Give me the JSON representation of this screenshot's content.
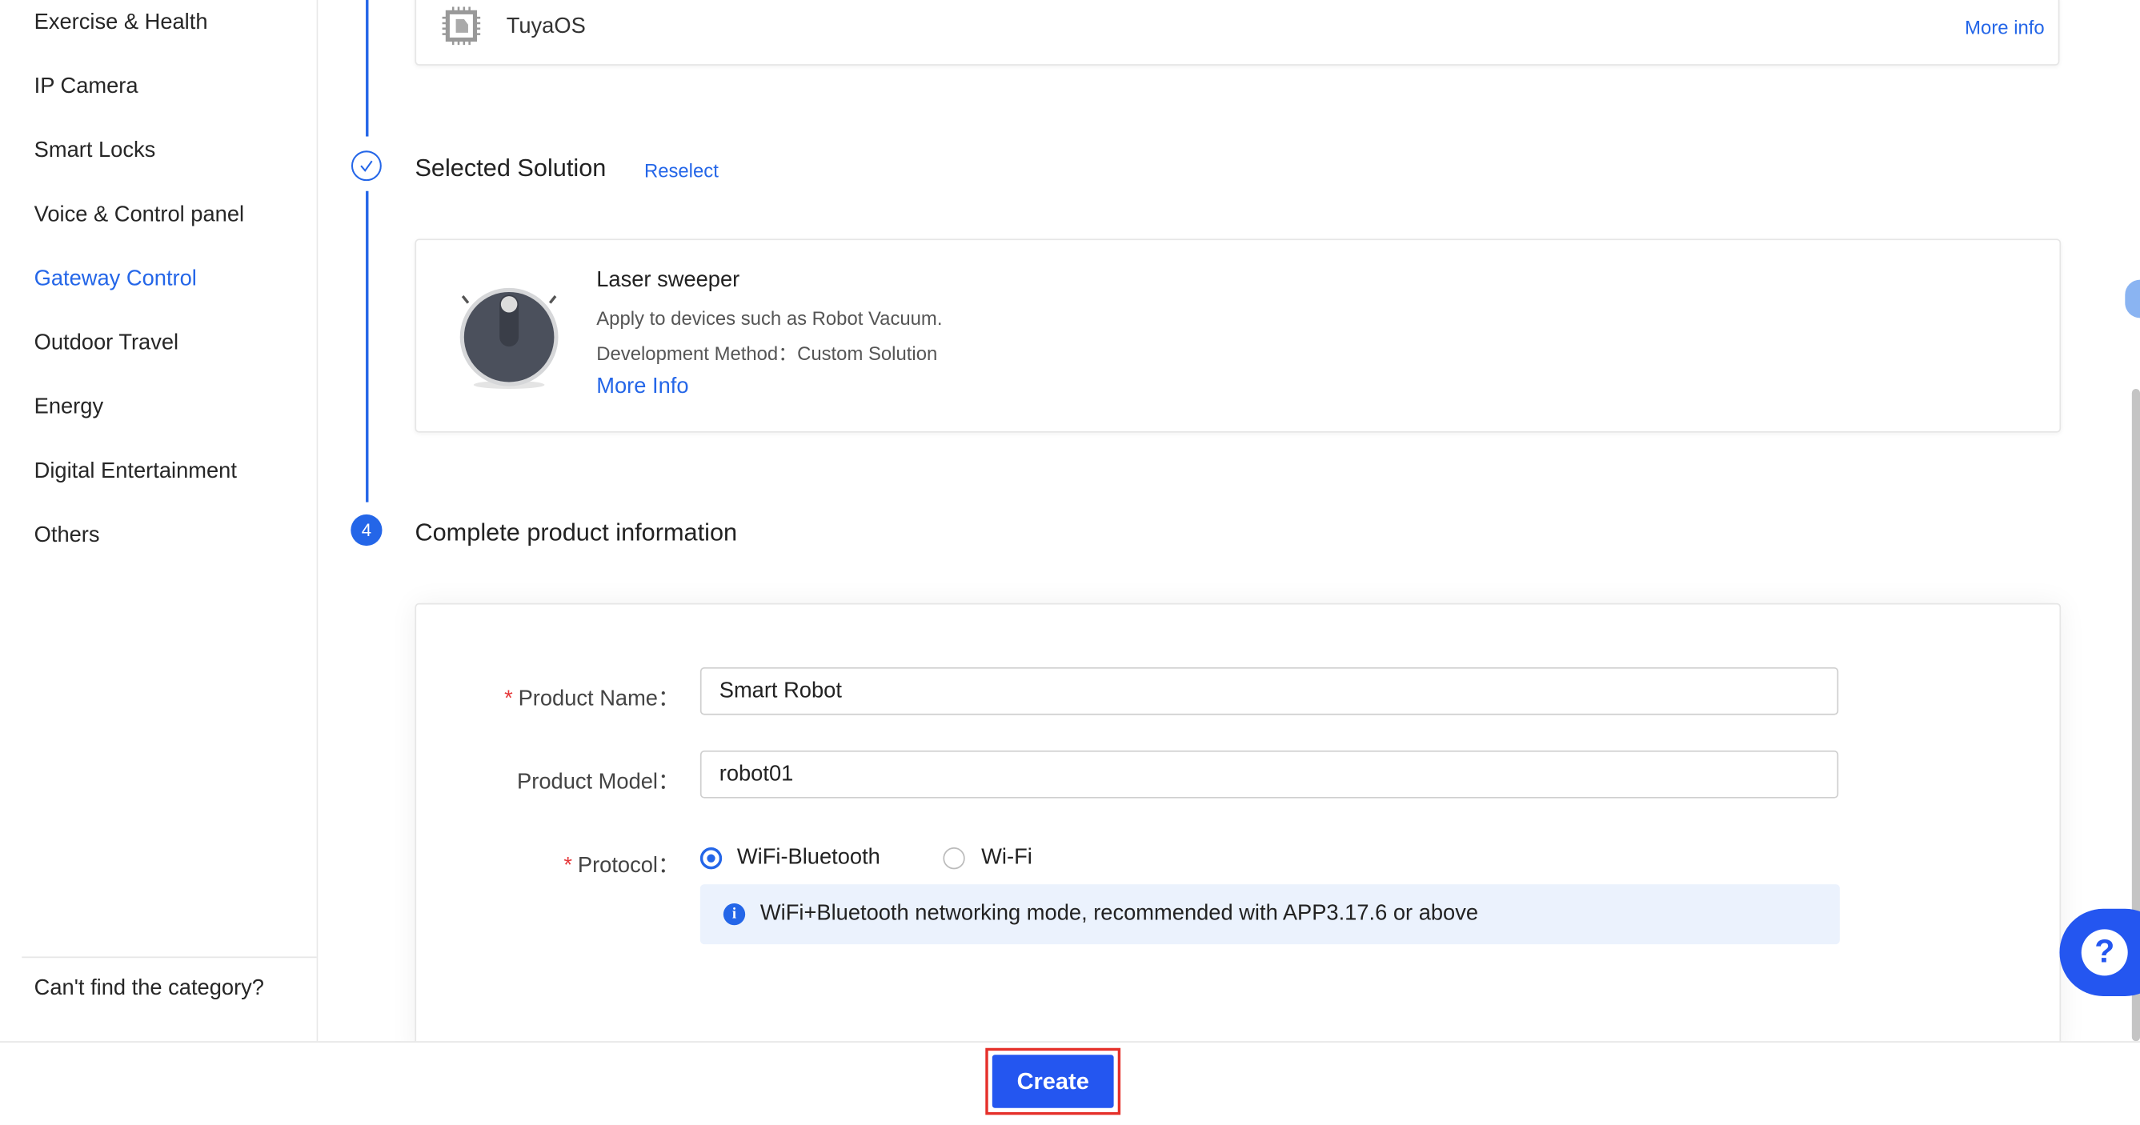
{
  "sidebar": {
    "items": [
      {
        "label": "Exercise & Health",
        "active": false
      },
      {
        "label": "IP Camera",
        "active": false
      },
      {
        "label": "Smart Locks",
        "active": false
      },
      {
        "label": "Voice & Control panel",
        "active": false
      },
      {
        "label": "Gateway Control",
        "active": true
      },
      {
        "label": "Outdoor Travel",
        "active": false
      },
      {
        "label": "Energy",
        "active": false
      },
      {
        "label": "Digital Entertainment",
        "active": false
      },
      {
        "label": "Others",
        "active": false
      }
    ],
    "footer_link": "Can't find the category?"
  },
  "os_card": {
    "name": "TuyaOS",
    "more": "More info",
    "icon": "chip-icon"
  },
  "step3": {
    "title": "Selected Solution",
    "reselect": "Reselect",
    "icon": "check-circle-icon"
  },
  "solution": {
    "name": "Laser sweeper",
    "desc": "Apply to devices such as Robot Vacuum.",
    "method": "Development Method：Custom Solution",
    "more": "More Info",
    "image": "robot-vacuum-image"
  },
  "step4": {
    "number": "4",
    "title": "Complete product information"
  },
  "form": {
    "product_name_label": "Product Name：",
    "product_name_value": "Smart Robot",
    "product_model_label": "Product Model：",
    "product_model_value": "robot01",
    "protocol_label": "Protocol：",
    "protocol_options": [
      {
        "label": "WiFi-Bluetooth",
        "selected": true
      },
      {
        "label": "Wi-Fi",
        "selected": false
      }
    ],
    "notice": "WiFi+Bluetooth networking mode, recommended with APP3.17.6 or above"
  },
  "footer": {
    "create": "Create"
  },
  "colors": {
    "accent": "#2466e8",
    "required": "#e5393b",
    "highlight_border": "#e5302a"
  }
}
